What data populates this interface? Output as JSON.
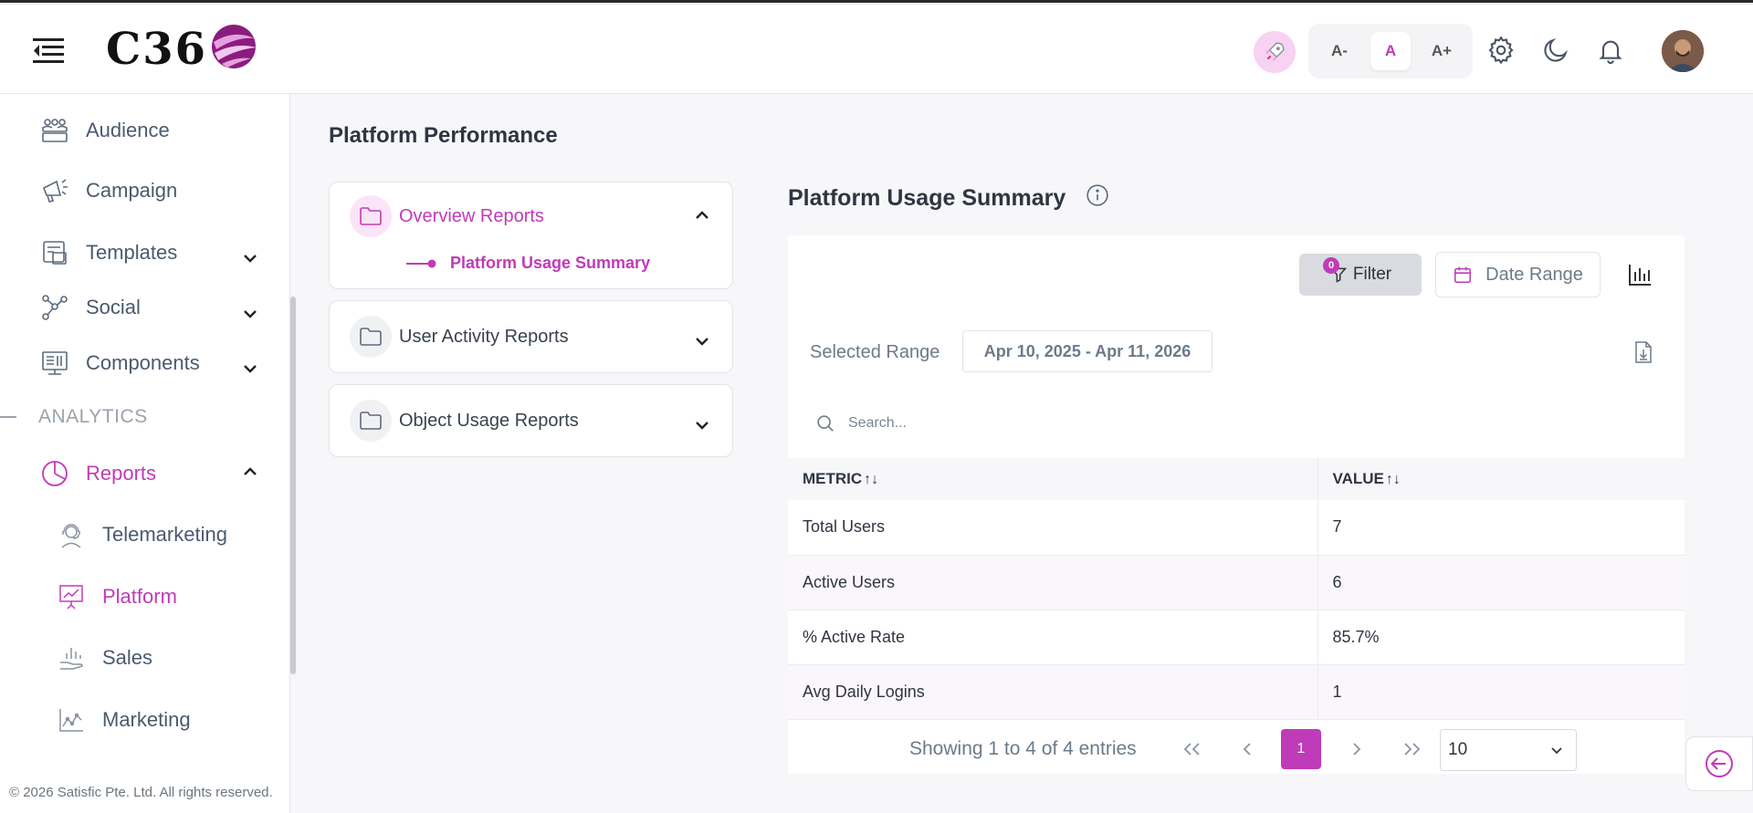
{
  "header": {
    "logo_text": "C36",
    "font_size_buttons": [
      "A-",
      "A",
      "A+"
    ],
    "active_font_size": "A"
  },
  "sidebar": {
    "items": [
      {
        "label": "Audience",
        "icon": "audience-icon"
      },
      {
        "label": "Campaign",
        "icon": "megaphone-icon"
      },
      {
        "label": "Templates",
        "icon": "template-icon",
        "expandable": true
      },
      {
        "label": "Social",
        "icon": "social-network-icon",
        "expandable": true
      },
      {
        "label": "Components",
        "icon": "components-icon",
        "expandable": true
      }
    ],
    "section_label": "ANALYTICS",
    "reports": {
      "label": "Reports",
      "icon": "pie-chart-icon",
      "expanded": true
    },
    "subitems": [
      {
        "label": "Telemarketing",
        "icon": "headset-icon"
      },
      {
        "label": "Platform",
        "icon": "presentation-chart-icon",
        "active": true
      },
      {
        "label": "Sales",
        "icon": "hand-chart-icon"
      },
      {
        "label": "Marketing",
        "icon": "line-chart-icon"
      }
    ],
    "copyright": "© 2026 Satisfic Pte. Ltd. All rights reserved."
  },
  "page": {
    "title": "Platform Performance"
  },
  "report_groups": [
    {
      "label": "Overview Reports",
      "expanded": true,
      "children": [
        "Platform Usage Summary"
      ]
    },
    {
      "label": "User Activity Reports",
      "expanded": false
    },
    {
      "label": "Object Usage Reports",
      "expanded": false
    }
  ],
  "report": {
    "title": "Platform Usage Summary",
    "filter_label": "Filter",
    "filter_count": "0",
    "date_range_label": "Date Range",
    "selected_range_label": "Selected Range",
    "selected_range_value": "Apr 10, 2025 - Apr 11, 2026",
    "search_placeholder": "Search..."
  },
  "table": {
    "columns": [
      "METRIC",
      "VALUE"
    ],
    "rows": [
      [
        "Total Users",
        "7"
      ],
      [
        "Active Users",
        "6"
      ],
      [
        "% Active Rate",
        "85.7%"
      ],
      [
        "Avg Daily Logins",
        "1"
      ]
    ]
  },
  "pagination": {
    "info": "Showing 1 to 4 of 4 entries",
    "current_page": "1",
    "page_size": "10"
  },
  "colors": {
    "accent": "#c03bb8",
    "text": "#2f3542",
    "muted": "#6c7a89"
  }
}
